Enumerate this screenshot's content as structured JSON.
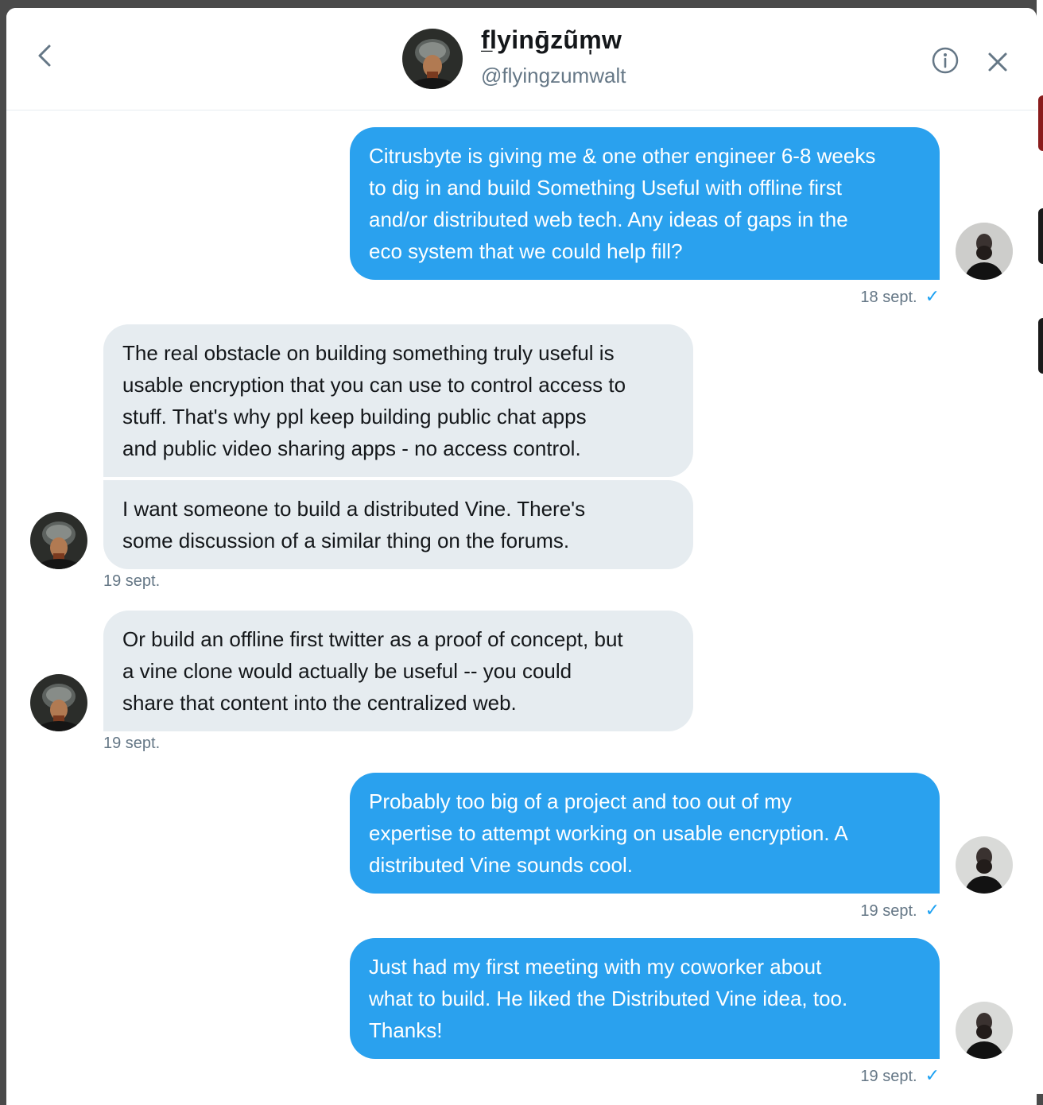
{
  "header": {
    "display_name": "f̲lyinḡzũm̩w",
    "handle": "@flyingzumwalt"
  },
  "messages": [
    {
      "text": "Citrusbyte is giving me & one other engineer 6-8 weeks\nto dig in and build Something Useful with offline first\nand/or distributed web tech. Any ideas of gaps in the\neco system that we could help fill?",
      "time": "18 sept."
    },
    {
      "text": "The real obstacle on building something truly useful is\nusable encryption that you can use to control access to\nstuff. That's why ppl keep building public chat apps\nand public video sharing apps - no access control."
    },
    {
      "text": "I want someone to build a distributed Vine. There's\nsome discussion of a similar thing on the forums.",
      "time": "19 sept."
    },
    {
      "text": "Or build an offline first twitter as a proof of concept, but\na vine clone would actually be useful -- you could\nshare that content into the centralized web.",
      "time": "19 sept."
    },
    {
      "text": "Probably too big of a project and too out of my\nexpertise to attempt working on usable encryption. A\ndistributed Vine sounds cool.",
      "time": "19 sept."
    },
    {
      "text": "Just had my first meeting with my coworker about\nwhat to build. He liked the Distributed Vine idea, too.\nThanks!",
      "time": "19 sept."
    }
  ],
  "icons": {
    "sent_check": "✓"
  },
  "colors": {
    "outgoing_bubble": "#2aa1ee",
    "incoming_bubble": "#e6ecf0",
    "timestamp": "#657786"
  }
}
